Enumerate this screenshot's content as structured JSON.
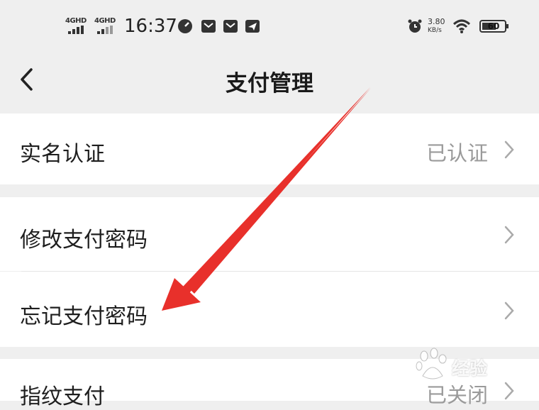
{
  "status_bar": {
    "signal1": "4GHD",
    "signal2": "4GHD",
    "time": "16:37",
    "net_speed_value": "3.80",
    "net_speed_unit": "KB/s",
    "battery": "60"
  },
  "nav": {
    "back_icon": "chevron-left-icon",
    "title": "支付管理"
  },
  "rows": [
    {
      "label": "实名认证",
      "value": "已认证"
    },
    {
      "label": "修改支付密码",
      "value": ""
    },
    {
      "label": "忘记支付密码",
      "value": ""
    },
    {
      "label": "指纹支付",
      "value": "已关闭"
    }
  ],
  "annotation": {
    "color": "#e8302b",
    "icon": "red-arrow"
  },
  "watermark": {
    "text": "经验"
  }
}
